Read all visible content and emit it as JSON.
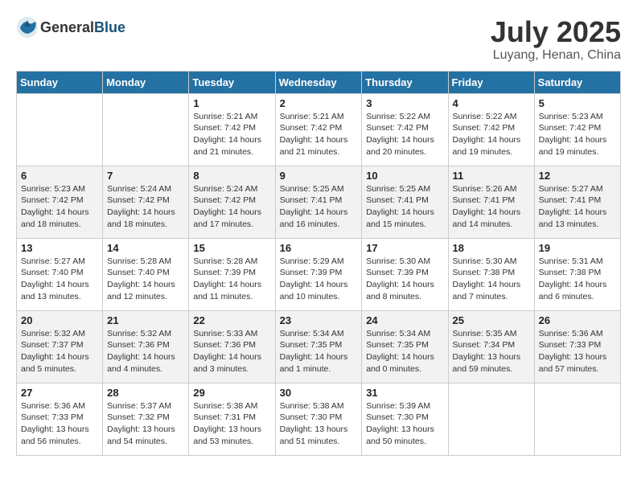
{
  "header": {
    "logo_general": "General",
    "logo_blue": "Blue",
    "title": "July 2025",
    "subtitle": "Luyang, Henan, China"
  },
  "weekdays": [
    "Sunday",
    "Monday",
    "Tuesday",
    "Wednesday",
    "Thursday",
    "Friday",
    "Saturday"
  ],
  "weeks": [
    [
      {
        "day": "",
        "sunrise": "",
        "sunset": "",
        "daylight": ""
      },
      {
        "day": "",
        "sunrise": "",
        "sunset": "",
        "daylight": ""
      },
      {
        "day": "1",
        "sunrise": "Sunrise: 5:21 AM",
        "sunset": "Sunset: 7:42 PM",
        "daylight": "Daylight: 14 hours and 21 minutes."
      },
      {
        "day": "2",
        "sunrise": "Sunrise: 5:21 AM",
        "sunset": "Sunset: 7:42 PM",
        "daylight": "Daylight: 14 hours and 21 minutes."
      },
      {
        "day": "3",
        "sunrise": "Sunrise: 5:22 AM",
        "sunset": "Sunset: 7:42 PM",
        "daylight": "Daylight: 14 hours and 20 minutes."
      },
      {
        "day": "4",
        "sunrise": "Sunrise: 5:22 AM",
        "sunset": "Sunset: 7:42 PM",
        "daylight": "Daylight: 14 hours and 19 minutes."
      },
      {
        "day": "5",
        "sunrise": "Sunrise: 5:23 AM",
        "sunset": "Sunset: 7:42 PM",
        "daylight": "Daylight: 14 hours and 19 minutes."
      }
    ],
    [
      {
        "day": "6",
        "sunrise": "Sunrise: 5:23 AM",
        "sunset": "Sunset: 7:42 PM",
        "daylight": "Daylight: 14 hours and 18 minutes."
      },
      {
        "day": "7",
        "sunrise": "Sunrise: 5:24 AM",
        "sunset": "Sunset: 7:42 PM",
        "daylight": "Daylight: 14 hours and 18 minutes."
      },
      {
        "day": "8",
        "sunrise": "Sunrise: 5:24 AM",
        "sunset": "Sunset: 7:42 PM",
        "daylight": "Daylight: 14 hours and 17 minutes."
      },
      {
        "day": "9",
        "sunrise": "Sunrise: 5:25 AM",
        "sunset": "Sunset: 7:41 PM",
        "daylight": "Daylight: 14 hours and 16 minutes."
      },
      {
        "day": "10",
        "sunrise": "Sunrise: 5:25 AM",
        "sunset": "Sunset: 7:41 PM",
        "daylight": "Daylight: 14 hours and 15 minutes."
      },
      {
        "day": "11",
        "sunrise": "Sunrise: 5:26 AM",
        "sunset": "Sunset: 7:41 PM",
        "daylight": "Daylight: 14 hours and 14 minutes."
      },
      {
        "day": "12",
        "sunrise": "Sunrise: 5:27 AM",
        "sunset": "Sunset: 7:41 PM",
        "daylight": "Daylight: 14 hours and 13 minutes."
      }
    ],
    [
      {
        "day": "13",
        "sunrise": "Sunrise: 5:27 AM",
        "sunset": "Sunset: 7:40 PM",
        "daylight": "Daylight: 14 hours and 13 minutes."
      },
      {
        "day": "14",
        "sunrise": "Sunrise: 5:28 AM",
        "sunset": "Sunset: 7:40 PM",
        "daylight": "Daylight: 14 hours and 12 minutes."
      },
      {
        "day": "15",
        "sunrise": "Sunrise: 5:28 AM",
        "sunset": "Sunset: 7:39 PM",
        "daylight": "Daylight: 14 hours and 11 minutes."
      },
      {
        "day": "16",
        "sunrise": "Sunrise: 5:29 AM",
        "sunset": "Sunset: 7:39 PM",
        "daylight": "Daylight: 14 hours and 10 minutes."
      },
      {
        "day": "17",
        "sunrise": "Sunrise: 5:30 AM",
        "sunset": "Sunset: 7:39 PM",
        "daylight": "Daylight: 14 hours and 8 minutes."
      },
      {
        "day": "18",
        "sunrise": "Sunrise: 5:30 AM",
        "sunset": "Sunset: 7:38 PM",
        "daylight": "Daylight: 14 hours and 7 minutes."
      },
      {
        "day": "19",
        "sunrise": "Sunrise: 5:31 AM",
        "sunset": "Sunset: 7:38 PM",
        "daylight": "Daylight: 14 hours and 6 minutes."
      }
    ],
    [
      {
        "day": "20",
        "sunrise": "Sunrise: 5:32 AM",
        "sunset": "Sunset: 7:37 PM",
        "daylight": "Daylight: 14 hours and 5 minutes."
      },
      {
        "day": "21",
        "sunrise": "Sunrise: 5:32 AM",
        "sunset": "Sunset: 7:36 PM",
        "daylight": "Daylight: 14 hours and 4 minutes."
      },
      {
        "day": "22",
        "sunrise": "Sunrise: 5:33 AM",
        "sunset": "Sunset: 7:36 PM",
        "daylight": "Daylight: 14 hours and 3 minutes."
      },
      {
        "day": "23",
        "sunrise": "Sunrise: 5:34 AM",
        "sunset": "Sunset: 7:35 PM",
        "daylight": "Daylight: 14 hours and 1 minute."
      },
      {
        "day": "24",
        "sunrise": "Sunrise: 5:34 AM",
        "sunset": "Sunset: 7:35 PM",
        "daylight": "Daylight: 14 hours and 0 minutes."
      },
      {
        "day": "25",
        "sunrise": "Sunrise: 5:35 AM",
        "sunset": "Sunset: 7:34 PM",
        "daylight": "Daylight: 13 hours and 59 minutes."
      },
      {
        "day": "26",
        "sunrise": "Sunrise: 5:36 AM",
        "sunset": "Sunset: 7:33 PM",
        "daylight": "Daylight: 13 hours and 57 minutes."
      }
    ],
    [
      {
        "day": "27",
        "sunrise": "Sunrise: 5:36 AM",
        "sunset": "Sunset: 7:33 PM",
        "daylight": "Daylight: 13 hours and 56 minutes."
      },
      {
        "day": "28",
        "sunrise": "Sunrise: 5:37 AM",
        "sunset": "Sunset: 7:32 PM",
        "daylight": "Daylight: 13 hours and 54 minutes."
      },
      {
        "day": "29",
        "sunrise": "Sunrise: 5:38 AM",
        "sunset": "Sunset: 7:31 PM",
        "daylight": "Daylight: 13 hours and 53 minutes."
      },
      {
        "day": "30",
        "sunrise": "Sunrise: 5:38 AM",
        "sunset": "Sunset: 7:30 PM",
        "daylight": "Daylight: 13 hours and 51 minutes."
      },
      {
        "day": "31",
        "sunrise": "Sunrise: 5:39 AM",
        "sunset": "Sunset: 7:30 PM",
        "daylight": "Daylight: 13 hours and 50 minutes."
      },
      {
        "day": "",
        "sunrise": "",
        "sunset": "",
        "daylight": ""
      },
      {
        "day": "",
        "sunrise": "",
        "sunset": "",
        "daylight": ""
      }
    ]
  ]
}
